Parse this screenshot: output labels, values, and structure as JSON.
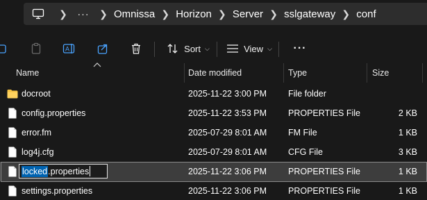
{
  "breadcrumb": {
    "more": "···",
    "items": [
      "Omnissa",
      "Horizon",
      "Server",
      "sslgateway",
      "conf"
    ]
  },
  "toolbar": {
    "sort_label": "Sort",
    "view_label": "View",
    "more": "···"
  },
  "columns": {
    "name": "Name",
    "date": "Date modified",
    "type": "Type",
    "size": "Size"
  },
  "files": [
    {
      "icon": "folder-icon",
      "name": "docroot",
      "date": "2025-11-22 3:00 PM",
      "type": "File folder",
      "size": ""
    },
    {
      "icon": "file-icon",
      "name": "config.properties",
      "date": "2025-11-22 3:53 PM",
      "type": "PROPERTIES File",
      "size": "2 KB"
    },
    {
      "icon": "file-icon",
      "name": "error.fm",
      "date": "2025-07-29 8:01 AM",
      "type": "FM File",
      "size": "1 KB"
    },
    {
      "icon": "file-icon",
      "name": "log4j.cfg",
      "date": "2025-07-29 8:01 AM",
      "type": "CFG File",
      "size": "3 KB"
    },
    {
      "icon": "file-icon",
      "name": "locked",
      "name_ext": ".properties",
      "date": "2025-11-22 3:06 PM",
      "type": "PROPERTIES File",
      "size": "1 KB",
      "selected": true,
      "renaming": true
    },
    {
      "icon": "file-icon",
      "name": "settings.properties",
      "date": "2025-11-22 3:06 PM",
      "type": "PROPERTIES File",
      "size": "1 KB"
    }
  ],
  "colors": {
    "background": "#191919",
    "address_bar": "#2d2d2d",
    "folder": "#f5c242",
    "selection": "#0063b1"
  }
}
